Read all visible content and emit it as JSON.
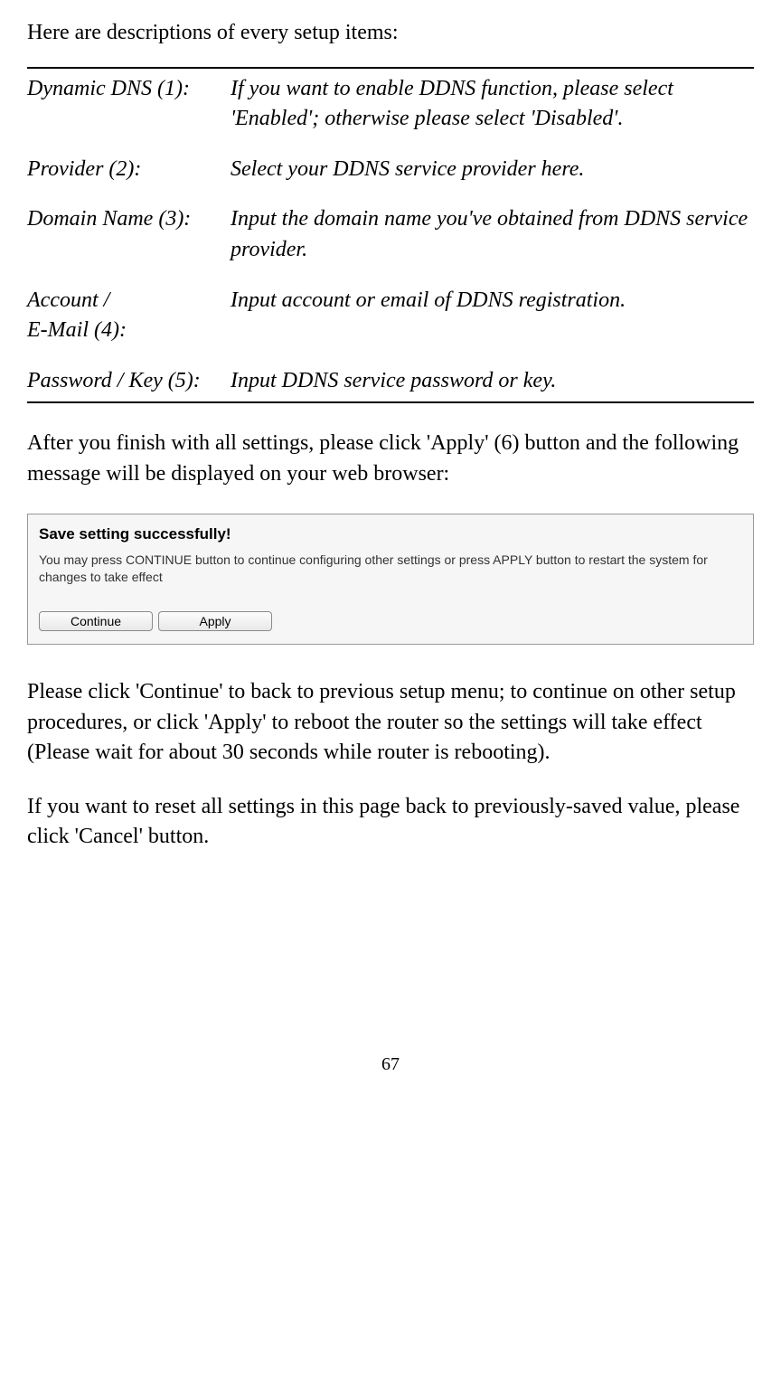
{
  "intro": "Here are descriptions of every setup items:",
  "definitions": [
    {
      "term": "Dynamic DNS (1):",
      "desc": "If you want to enable DDNS function, please select 'Enabled'; otherwise please select 'Disabled'."
    },
    {
      "term": "Provider (2):",
      "desc": "Select your DDNS service provider here."
    },
    {
      "term": "Domain Name (3):",
      "desc": "Input the domain name you've obtained from DDNS service provider."
    },
    {
      "term": "Account /\nE-Mail (4):",
      "desc": "Input account or email of DDNS registration."
    },
    {
      "term": "Password / Key (5):",
      "desc": "Input DDNS service password or key."
    }
  ],
  "after_apply": "After you finish with all settings, please click 'Apply' (6) button and the following message will be displayed on your web browser:",
  "screenshot": {
    "title": "Save setting successfully!",
    "body": "You may press CONTINUE button to continue configuring other settings or press APPLY button to restart the system for changes to take effect",
    "continue_label": "Continue",
    "apply_label": "Apply"
  },
  "continue_text": "Please click 'Continue' to back to previous setup menu; to continue on other setup procedures, or click 'Apply' to reboot the router so the settings will take effect (Please wait for about 30 seconds while router is rebooting).",
  "cancel_text": "If you want to reset all settings in this page back to previously-saved value, please click 'Cancel' button.",
  "page_number": "67"
}
